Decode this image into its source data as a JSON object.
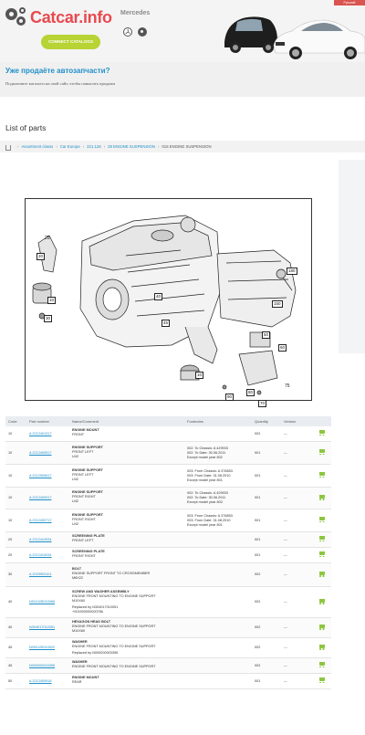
{
  "header": {
    "logo_text": "Catcar.info",
    "connect_label": "CONNECT CATALOGS",
    "brand": "Mercedes",
    "lang": "Русский"
  },
  "banner": {
    "title": "Уже продаёте автозапчасти?",
    "text": "Подключите каталоги на свой сайт, чтобы повысить продажи"
  },
  "page_title": "List of parts",
  "breadcrumbs": [
    "Assortment classs",
    "Car Europe",
    "221.126",
    "28 ENGINE SUSPENSION",
    "015 ENGINE SUSPENSION"
  ],
  "diagram": {
    "callouts": [
      "25",
      "20",
      "10",
      "30",
      "40",
      "45",
      "50",
      "60",
      "150",
      "180",
      "10",
      "90",
      "80",
      "70",
      "75"
    ]
  },
  "table": {
    "columns": [
      "Code",
      "Part number",
      "Name/Comment",
      "Footnotes",
      "Quantity",
      "Version"
    ],
    "rows": [
      {
        "code": "10",
        "part": "A 2212401317",
        "name": "ENGINE MOUNT",
        "comment": "FRONT",
        "replaced": "",
        "foot": "",
        "qty": "002",
        "ver": "---"
      },
      {
        "code": "10",
        "part": "A 2212400517",
        "name": "ENGINE SUPPORT",
        "comment": "FRONT LEFT\nU42",
        "replaced": "",
        "foot": "002: To Chassis: A 429933\n002: To Date: 30.06.2011\nExcept model year 802",
        "qty": "001",
        "ver": "---"
      },
      {
        "code": "10",
        "part": "A 2212900617",
        "name": "ENGINE SUPPORT",
        "comment": "FRONT LEFT\nU42",
        "replaced": "",
        "foot": "003: From Chassis: A 376853\n003: From Date: 31.08.2010\nExcept model year 801",
        "qty": "001",
        "ver": "---"
      },
      {
        "code": "10",
        "part": "A 2212400917",
        "name": "ENGINE SUPPORT",
        "comment": "FRONT RIGHT\nU42",
        "replaced": "",
        "foot": "002: To Chassis: A 429933\n002: To Date: 30.06.2011\nExcept model year 802",
        "qty": "001",
        "ver": "---"
      },
      {
        "code": "10",
        "part": "A 2212400717",
        "name": "ENGINE SUPPORT",
        "comment": "FRONT RIGHT\nU42",
        "replaced": "",
        "foot": "003: From Chassis: A 376853\n003: From Date: 31.08.2010\nExcept model year 801",
        "qty": "001",
        "ver": "---"
      },
      {
        "code": "20",
        "part": "A 2212410934",
        "name": "SCREENING PLATE",
        "comment": "FRONT LEFT",
        "replaced": "",
        "foot": "",
        "qty": "001",
        "ver": "---"
      },
      {
        "code": "20",
        "part": "A 2212410034",
        "name": "SCREENING PLATE",
        "comment": "FRONT RIGHT",
        "replaced": "",
        "foot": "",
        "qty": "001",
        "ver": "---"
      },
      {
        "code": "30",
        "part": "A 2029903101",
        "name": "BOLT",
        "comment": "ENGINE SUPPORT FRONT TO CROSSMEMBER\nM8X22",
        "replaced": "",
        "foot": "",
        "qty": "002",
        "ver": "---"
      },
      {
        "code": "40",
        "part": "N910105010066",
        "name": "SCREW AND WASHER ASSEMBLY",
        "comment": "ENGINE FRONT MOUNTING TO ENGINE SUPPORT\nM10X60",
        "replaced": "Replaced by N304017010051\n+001900000000786",
        "foot": "",
        "qty": "002",
        "ver": "---"
      },
      {
        "code": "40",
        "part": "N304017010051",
        "name": "HEXAGON HEAD BOLT",
        "comment": "ENGINE FRONT MOUNTING TO ENGINE SUPPORT\nM10X60",
        "replaced": "",
        "foot": "",
        "qty": "002",
        "ver": "---"
      },
      {
        "code": "45",
        "part": "N000125010022",
        "name": "WASHER",
        "comment": "ENGINE FRONT MOUNTING TO ENGINE SUPPORT",
        "replaced": "Replaced by N000000003396",
        "foot": "",
        "qty": "002",
        "ver": "---"
      },
      {
        "code": "45",
        "part": "N000000003396",
        "name": "WASHER",
        "comment": "ENGINE FRONT MOUNTING TO ENGINE SUPPORT",
        "replaced": "",
        "foot": "",
        "qty": "002",
        "ver": "---"
      },
      {
        "code": "50",
        "part": "A 2212400918",
        "name": "ENGINE MOUNT",
        "comment": "REAR",
        "replaced": "",
        "foot": "",
        "qty": "001",
        "ver": "---"
      }
    ]
  },
  "colors": {
    "accent": "#1f8fc8",
    "brand_red": "#e8494f",
    "connect_green": "#b7d334",
    "cart_green": "#8cc63f"
  }
}
